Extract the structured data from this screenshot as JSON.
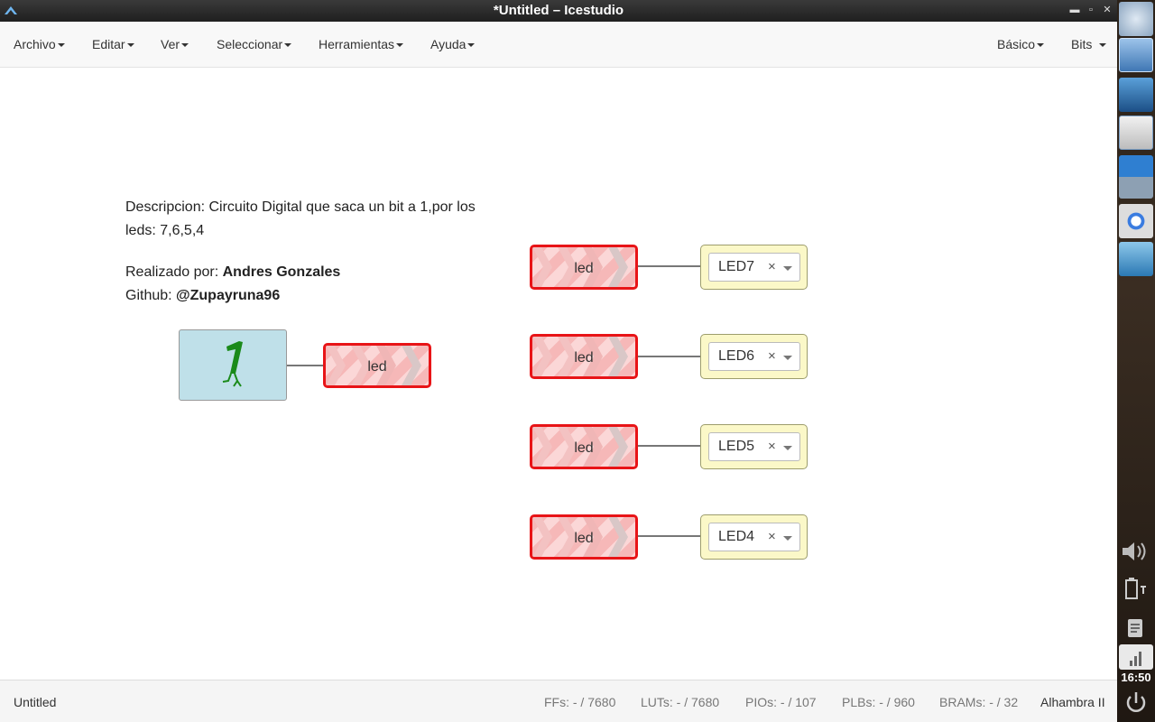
{
  "window": {
    "title": "*Untitled – Icestudio"
  },
  "menubar": {
    "left": [
      {
        "label": "Archivo"
      },
      {
        "label": "Editar"
      },
      {
        "label": "Ver"
      },
      {
        "label": "Seleccionar"
      },
      {
        "label": "Herramientas"
      },
      {
        "label": "Ayuda"
      }
    ],
    "right": [
      {
        "label": "Básico"
      },
      {
        "label": "Bits"
      }
    ]
  },
  "canvas": {
    "info": {
      "line1": "Descripcion: Circuito Digital que saca un bit a 1,por los",
      "line2": "leds: 7,6,5,4",
      "author_prefix": "Realizado por: ",
      "author": "Andres Gonzales",
      "github_prefix": "Github: ",
      "github": "@Zupayruna96"
    },
    "constant_block": {
      "value": "1",
      "label_out": "led"
    },
    "labels": [
      {
        "text": "led",
        "output": "LED7"
      },
      {
        "text": "led",
        "output": "LED6"
      },
      {
        "text": "led",
        "output": "LED5"
      },
      {
        "text": "led",
        "output": "LED4"
      }
    ],
    "clear_symbol": "×"
  },
  "statusbar": {
    "file": "Untitled",
    "ffs": "FFs:  - / 7680",
    "luts": "LUTs:  - / 7680",
    "pios": "PIOs:  - / 107",
    "plbs": "PLBs:  - / 960",
    "brams": "BRAMs:  - / 32",
    "board": "Alhambra II"
  },
  "dock": {
    "clock": "16:50",
    "icons": [
      "file-manager-icon",
      "network-map-icon",
      "window-icon",
      "icestudio-icon",
      "chrome-icon",
      "cube-app-icon",
      "volume-icon",
      "battery-icon",
      "notes-icon",
      "signal-icon",
      "power-icon"
    ]
  }
}
